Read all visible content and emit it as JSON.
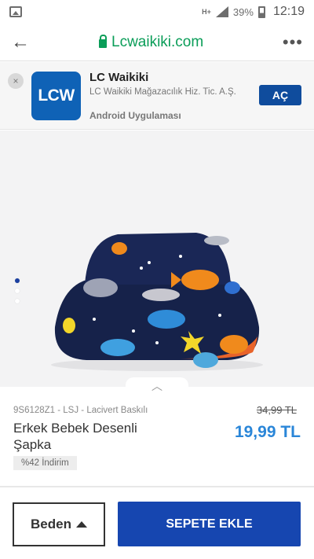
{
  "status_bar": {
    "network": "H+",
    "battery_percent": "39%",
    "time": "12:19",
    "icons": [
      "image-icon",
      "signal-icon",
      "battery-icon"
    ]
  },
  "browser": {
    "back_icon": "back-arrow-icon",
    "url": "Lcwaikiki.com",
    "lock_icon": "lock-icon",
    "menu_icon": "more-dots-icon",
    "url_color": "#0a9d58"
  },
  "app_banner": {
    "close_symbol": "×",
    "logo_text": "LCW",
    "title": "LC Waikiki",
    "subtitle": "LC Waikiki Mağazacılık Hiz. Tic. A.Ş.",
    "platform": "Android Uygulaması",
    "open_label": "AÇ",
    "brand_color": "#0f62b6"
  },
  "product": {
    "image_subject": "bucket-hat-image",
    "carousel": {
      "count": 3,
      "active_index": 0
    },
    "collapse_icon": "chevron-up-icon",
    "collapse_symbol": "︿",
    "sku": "9S6128Z1 - LSJ - Lacivert Baskılı",
    "name": "Erkek Bebek Desenli Şapka",
    "discount_badge": "%42 İndirim",
    "old_price": "34,99 TL",
    "new_price": "19,99 TL",
    "price_color": "#2a86d8"
  },
  "actions": {
    "size_label": "Beden",
    "add_to_cart_label": "SEPETE EKLE",
    "add_to_cart_color": "#1646b0"
  }
}
